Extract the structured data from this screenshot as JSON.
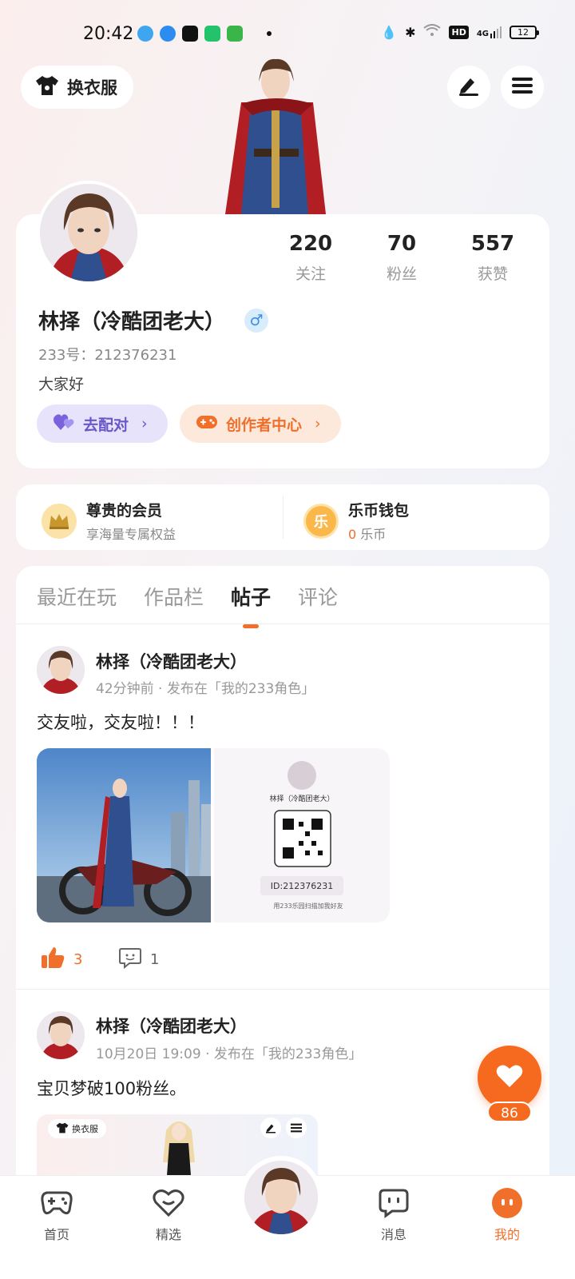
{
  "status_bar": {
    "time": "20:42",
    "network": "4G",
    "hd": "HD",
    "battery": "12"
  },
  "header": {
    "wardrobe_label": "换衣服"
  },
  "profile": {
    "stats": [
      {
        "value": "220",
        "label": "关注"
      },
      {
        "value": "70",
        "label": "粉丝"
      },
      {
        "value": "557",
        "label": "获赞"
      }
    ],
    "name": "林择（冷酷团老大）",
    "gender_symbol": "♂",
    "id_text": "233号：212376231",
    "bio": "大家好",
    "match_label": "去配对",
    "creator_label": "创作者中心"
  },
  "membership": {
    "vip_title": "尊贵的会员",
    "vip_sub": "享海量专属权益",
    "wallet_icon": "乐",
    "wallet_title": "乐币钱包",
    "wallet_amount": "0",
    "wallet_unit": "乐币"
  },
  "tabs": [
    {
      "label": "最近在玩"
    },
    {
      "label": "作品栏"
    },
    {
      "label": "帖子",
      "active": true
    },
    {
      "label": "评论"
    }
  ],
  "posts": [
    {
      "author": "林择（冷酷团老大）",
      "time": "42分钟前",
      "published_in": "发布在「我的233角色」",
      "text": "交友啦，交友啦！！！",
      "likes": "3",
      "comments": "1",
      "card_name": "林择（冷酷团老大）",
      "card_id": "ID:212376231",
      "card_hint": "用233乐园扫描加我好友"
    },
    {
      "author": "林择（冷酷团老大）",
      "time": "10月20日 19:09",
      "published_in": "发布在「我的233角色」",
      "text": "宝贝梦破100粉丝。",
      "preview_wardrobe": "换衣服"
    }
  ],
  "heart_fab": {
    "count": "86"
  },
  "bottom_nav": [
    {
      "label": "首页"
    },
    {
      "label": "精选"
    },
    {
      "label": "消息"
    },
    {
      "label": "我的"
    }
  ],
  "colors": {
    "accent": "#f06f2a",
    "match": "#6a55c9",
    "gender": "#3b8ee8"
  }
}
